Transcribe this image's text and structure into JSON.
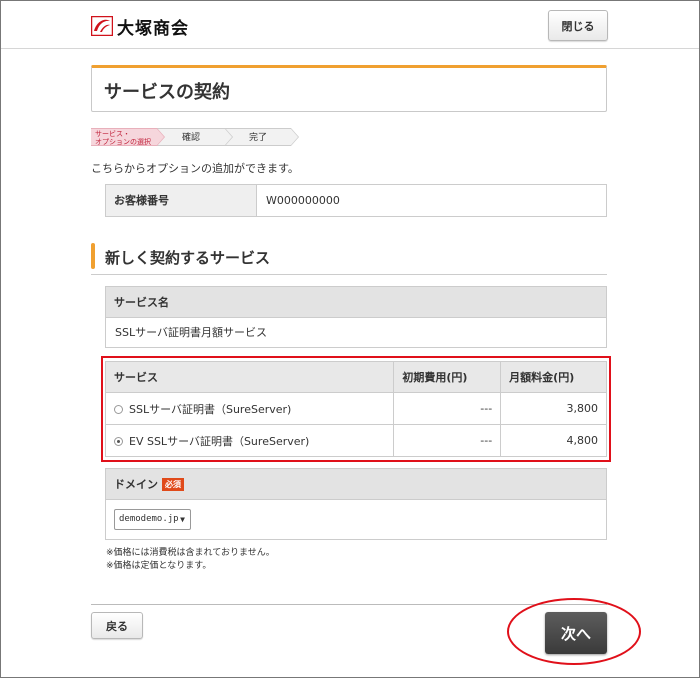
{
  "header": {
    "logo_text": "大塚商会",
    "close_label": "閉じる"
  },
  "page": {
    "title": "サービスの契約",
    "intro": "こちらからオプションの追加ができます。"
  },
  "steps": [
    {
      "label_line1": "サービス・",
      "label_line2": "オプションの選択"
    },
    {
      "label": "確認"
    },
    {
      "label": "完了"
    }
  ],
  "customer": {
    "label": "お客様番号",
    "value": "W000000000"
  },
  "section": {
    "title": "新しく契約するサービス"
  },
  "service_name": {
    "header": "サービス名",
    "value": "SSLサーバ証明書月額サービス"
  },
  "options": {
    "headers": [
      "サービス",
      "初期費用(円)",
      "月額料金(円)"
    ],
    "rows": [
      {
        "name": "SSLサーバ証明書（SureServer)",
        "initial": "---",
        "monthly": "3,800",
        "checked": false
      },
      {
        "name": "EV SSLサーバ証明書（SureServer)",
        "initial": "---",
        "monthly": "4,800",
        "checked": true
      }
    ]
  },
  "domain": {
    "label": "ドメイン",
    "required_badge": "必須",
    "selected": "demodemo.jp"
  },
  "notes": [
    "※価格には消費税は含まれておりません。",
    "※価格は定価となります。"
  ],
  "footer": {
    "back_label": "戻る",
    "next_label": "次へ"
  },
  "colors": {
    "accent": "#f0a030",
    "highlight": "#e0101a",
    "required": "#e04a1a",
    "active_step": "#f6d6dc"
  }
}
